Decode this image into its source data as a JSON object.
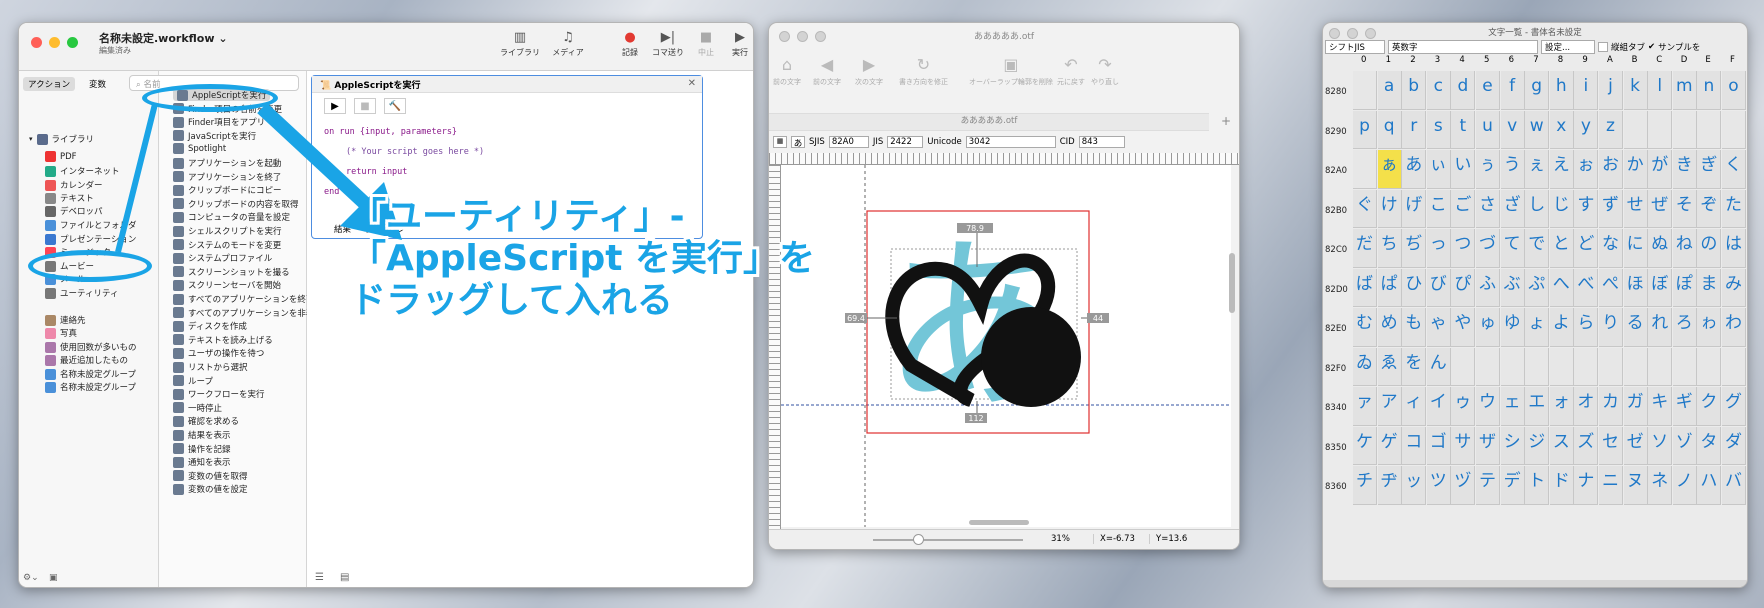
{
  "automator": {
    "title": "名称未設定.workflow",
    "subtitle": "編集済み",
    "toolbar": [
      {
        "label": "ライブラリ",
        "icon": "sidebar-icon"
      },
      {
        "label": "メディア",
        "icon": "media-icon"
      },
      {
        "label": "記録",
        "icon": "record-icon"
      },
      {
        "label": "コマ送り",
        "icon": "step-icon"
      },
      {
        "label": "中止",
        "icon": "stop-icon"
      },
      {
        "label": "実行",
        "icon": "run-icon"
      }
    ],
    "tabs": {
      "actions": "アクション",
      "variables": "変数"
    },
    "search_placeholder": "名前",
    "library": [
      "ライブラリ",
      "PDF",
      "インターネット",
      "カレンダー",
      "テキスト",
      "デベロッパ",
      "ファイルとフォルダ",
      "プレゼンテーション",
      "ミュージック",
      "ムービー",
      "メール",
      "ユーティリティ",
      "連絡先",
      "写真",
      "使用回数が多いもの",
      "最近追加したもの",
      "名称未設定グループ",
      "名称未設定グループ"
    ],
    "actions": [
      "AppleScriptを実行",
      "Finder項目の名前を変更",
      "Finder項目をアプリ",
      "JavaScriptを実行",
      "Spotlight",
      "アプリケーションを起動",
      "アプリケーションを終了",
      "クリップボードにコピー",
      "クリップボードの内容を取得",
      "コンピュータの音量を設定",
      "シェルスクリプトを実行",
      "システムのモードを変更",
      "システムプロファイル",
      "スクリーンショットを撮る",
      "スクリーンセーバを開始",
      "すべてのアプリケーションを終了",
      "すべてのアプリケーションを非表示",
      "ディスクを作成",
      "テキストを読み上げる",
      "ユーザの操作を待つ",
      "リストから選択",
      "ループ",
      "ワークフローを実行",
      "一時停止",
      "確認を求める",
      "結果を表示",
      "操作を記録",
      "通知を表示",
      "変数の値を取得",
      "変数の値を設定"
    ],
    "action_panel": {
      "title": "AppleScriptを実行",
      "code": [
        "on run {input, parameters}",
        "(* Your script goes here *)",
        "return input",
        "end run"
      ],
      "footer_tabs": [
        "結果",
        "オプション"
      ]
    }
  },
  "callout": {
    "line1": "「ユーティリティ」-",
    "line2": "「AppleScript を実行」を",
    "line3": "ドラッグして入れる"
  },
  "font_editor": {
    "title": "あああああ.otf",
    "subtitle": "あああああ.otf",
    "toolbar": [
      "前の文字",
      "前の文字",
      "次の文字",
      "書き方向を修正",
      "オーバーラップ輪郭を削除",
      "元に戻す",
      "やり直し"
    ],
    "glyph": "あ",
    "sjis_label": "SJIS",
    "sjis": "82A0",
    "jis_label": "JIS",
    "jis": "2422",
    "unicode_label": "Unicode",
    "unicode": "3042",
    "cid_label": "CID",
    "cid": "843",
    "dim_top": "78.9",
    "dim_left": "69.4",
    "dim_right": "44",
    "dim_bottom": "112",
    "zoom": "31%",
    "coord_x": "X=-6.73",
    "coord_y": "Y=13.6"
  },
  "glyph_list": {
    "title": "文字一覧 - 書体名未設定",
    "encoding": "シフトJIS",
    "category": "英数字",
    "settings": "設定...",
    "option_tab": "縦組タブ",
    "option_sample": "サンプルを",
    "columns": [
      "0",
      "1",
      "2",
      "3",
      "4",
      "5",
      "6",
      "7",
      "8",
      "9",
      "A",
      "B",
      "C",
      "D",
      "E",
      "F"
    ],
    "rows": [
      {
        "label": "8280",
        "cells": [
          "",
          "a",
          "b",
          "c",
          "d",
          "e",
          "f",
          "g",
          "h",
          "i",
          "j",
          "k",
          "l",
          "m",
          "n",
          "o"
        ]
      },
      {
        "label": "8290",
        "cells": [
          "p",
          "q",
          "r",
          "s",
          "t",
          "u",
          "v",
          "w",
          "x",
          "y",
          "z",
          "",
          "",
          "",
          "",
          ""
        ]
      },
      {
        "label": "82A0",
        "cells": [
          "",
          "ぁ",
          "あ",
          "ぃ",
          "い",
          "ぅ",
          "う",
          "ぇ",
          "え",
          "ぉ",
          "お",
          "か",
          "が",
          "き",
          "ぎ",
          "く"
        ]
      },
      {
        "label": "82B0",
        "cells": [
          "ぐ",
          "け",
          "げ",
          "こ",
          "ご",
          "さ",
          "ざ",
          "し",
          "じ",
          "す",
          "ず",
          "せ",
          "ぜ",
          "そ",
          "ぞ",
          "た"
        ]
      },
      {
        "label": "82C0",
        "cells": [
          "だ",
          "ち",
          "ぢ",
          "っ",
          "つ",
          "づ",
          "て",
          "で",
          "と",
          "ど",
          "な",
          "に",
          "ぬ",
          "ね",
          "の",
          "は"
        ]
      },
      {
        "label": "82D0",
        "cells": [
          "ば",
          "ぱ",
          "ひ",
          "び",
          "ぴ",
          "ふ",
          "ぶ",
          "ぷ",
          "へ",
          "べ",
          "ぺ",
          "ほ",
          "ぼ",
          "ぽ",
          "ま",
          "み"
        ]
      },
      {
        "label": "82E0",
        "cells": [
          "む",
          "め",
          "も",
          "ゃ",
          "や",
          "ゅ",
          "ゆ",
          "ょ",
          "よ",
          "ら",
          "り",
          "る",
          "れ",
          "ろ",
          "ゎ",
          "わ"
        ]
      },
      {
        "label": "82F0",
        "cells": [
          "ゐ",
          "ゑ",
          "を",
          "ん",
          "",
          "",
          "",
          "",
          "",
          "",
          "",
          "",
          "",
          "",
          "",
          ""
        ]
      },
      {
        "label": "8340",
        "cells": [
          "ァ",
          "ア",
          "ィ",
          "イ",
          "ゥ",
          "ウ",
          "ェ",
          "エ",
          "ォ",
          "オ",
          "カ",
          "ガ",
          "キ",
          "ギ",
          "ク",
          "グ"
        ]
      },
      {
        "label": "8350",
        "cells": [
          "ケ",
          "ゲ",
          "コ",
          "ゴ",
          "サ",
          "ザ",
          "シ",
          "ジ",
          "ス",
          "ズ",
          "セ",
          "ゼ",
          "ソ",
          "ゾ",
          "タ",
          "ダ"
        ]
      },
      {
        "label": "8360",
        "cells": [
          "チ",
          "ヂ",
          "ッ",
          "ツ",
          "ヅ",
          "テ",
          "デ",
          "ト",
          "ド",
          "ナ",
          "ニ",
          "ヌ",
          "ネ",
          "ノ",
          "ハ",
          "バ"
        ]
      }
    ]
  },
  "colors": {
    "accent": "#1aa4e6",
    "glyph_blue": "#1f78c8",
    "glyph_cyan": "#73c6d8"
  }
}
